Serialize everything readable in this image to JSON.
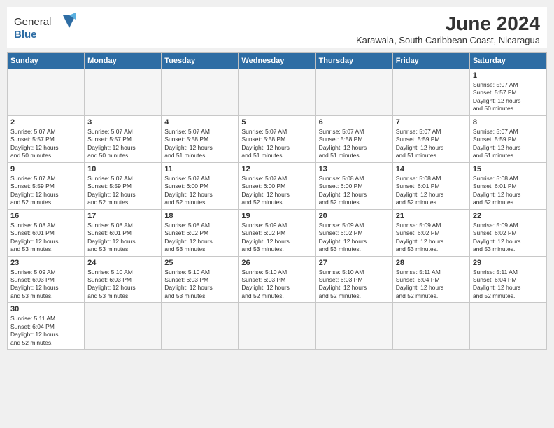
{
  "header": {
    "logo_general": "General",
    "logo_blue": "Blue",
    "main_title": "June 2024",
    "subtitle": "Karawala, South Caribbean Coast, Nicaragua"
  },
  "weekdays": [
    "Sunday",
    "Monday",
    "Tuesday",
    "Wednesday",
    "Thursday",
    "Friday",
    "Saturday"
  ],
  "weeks": [
    [
      {
        "day": "",
        "info": ""
      },
      {
        "day": "",
        "info": ""
      },
      {
        "day": "",
        "info": ""
      },
      {
        "day": "",
        "info": ""
      },
      {
        "day": "",
        "info": ""
      },
      {
        "day": "",
        "info": ""
      },
      {
        "day": "1",
        "info": "Sunrise: 5:07 AM\nSunset: 5:57 PM\nDaylight: 12 hours\nand 50 minutes."
      }
    ],
    [
      {
        "day": "2",
        "info": "Sunrise: 5:07 AM\nSunset: 5:57 PM\nDaylight: 12 hours\nand 50 minutes."
      },
      {
        "day": "3",
        "info": "Sunrise: 5:07 AM\nSunset: 5:57 PM\nDaylight: 12 hours\nand 50 minutes."
      },
      {
        "day": "4",
        "info": "Sunrise: 5:07 AM\nSunset: 5:58 PM\nDaylight: 12 hours\nand 51 minutes."
      },
      {
        "day": "5",
        "info": "Sunrise: 5:07 AM\nSunset: 5:58 PM\nDaylight: 12 hours\nand 51 minutes."
      },
      {
        "day": "6",
        "info": "Sunrise: 5:07 AM\nSunset: 5:58 PM\nDaylight: 12 hours\nand 51 minutes."
      },
      {
        "day": "7",
        "info": "Sunrise: 5:07 AM\nSunset: 5:59 PM\nDaylight: 12 hours\nand 51 minutes."
      },
      {
        "day": "8",
        "info": "Sunrise: 5:07 AM\nSunset: 5:59 PM\nDaylight: 12 hours\nand 51 minutes."
      }
    ],
    [
      {
        "day": "9",
        "info": "Sunrise: 5:07 AM\nSunset: 5:59 PM\nDaylight: 12 hours\nand 52 minutes."
      },
      {
        "day": "10",
        "info": "Sunrise: 5:07 AM\nSunset: 5:59 PM\nDaylight: 12 hours\nand 52 minutes."
      },
      {
        "day": "11",
        "info": "Sunrise: 5:07 AM\nSunset: 6:00 PM\nDaylight: 12 hours\nand 52 minutes."
      },
      {
        "day": "12",
        "info": "Sunrise: 5:07 AM\nSunset: 6:00 PM\nDaylight: 12 hours\nand 52 minutes."
      },
      {
        "day": "13",
        "info": "Sunrise: 5:08 AM\nSunset: 6:00 PM\nDaylight: 12 hours\nand 52 minutes."
      },
      {
        "day": "14",
        "info": "Sunrise: 5:08 AM\nSunset: 6:01 PM\nDaylight: 12 hours\nand 52 minutes."
      },
      {
        "day": "15",
        "info": "Sunrise: 5:08 AM\nSunset: 6:01 PM\nDaylight: 12 hours\nand 52 minutes."
      }
    ],
    [
      {
        "day": "16",
        "info": "Sunrise: 5:08 AM\nSunset: 6:01 PM\nDaylight: 12 hours\nand 53 minutes."
      },
      {
        "day": "17",
        "info": "Sunrise: 5:08 AM\nSunset: 6:01 PM\nDaylight: 12 hours\nand 53 minutes."
      },
      {
        "day": "18",
        "info": "Sunrise: 5:08 AM\nSunset: 6:02 PM\nDaylight: 12 hours\nand 53 minutes."
      },
      {
        "day": "19",
        "info": "Sunrise: 5:09 AM\nSunset: 6:02 PM\nDaylight: 12 hours\nand 53 minutes."
      },
      {
        "day": "20",
        "info": "Sunrise: 5:09 AM\nSunset: 6:02 PM\nDaylight: 12 hours\nand 53 minutes."
      },
      {
        "day": "21",
        "info": "Sunrise: 5:09 AM\nSunset: 6:02 PM\nDaylight: 12 hours\nand 53 minutes."
      },
      {
        "day": "22",
        "info": "Sunrise: 5:09 AM\nSunset: 6:02 PM\nDaylight: 12 hours\nand 53 minutes."
      }
    ],
    [
      {
        "day": "23",
        "info": "Sunrise: 5:09 AM\nSunset: 6:03 PM\nDaylight: 12 hours\nand 53 minutes."
      },
      {
        "day": "24",
        "info": "Sunrise: 5:10 AM\nSunset: 6:03 PM\nDaylight: 12 hours\nand 53 minutes."
      },
      {
        "day": "25",
        "info": "Sunrise: 5:10 AM\nSunset: 6:03 PM\nDaylight: 12 hours\nand 53 minutes."
      },
      {
        "day": "26",
        "info": "Sunrise: 5:10 AM\nSunset: 6:03 PM\nDaylight: 12 hours\nand 52 minutes."
      },
      {
        "day": "27",
        "info": "Sunrise: 5:10 AM\nSunset: 6:03 PM\nDaylight: 12 hours\nand 52 minutes."
      },
      {
        "day": "28",
        "info": "Sunrise: 5:11 AM\nSunset: 6:04 PM\nDaylight: 12 hours\nand 52 minutes."
      },
      {
        "day": "29",
        "info": "Sunrise: 5:11 AM\nSunset: 6:04 PM\nDaylight: 12 hours\nand 52 minutes."
      }
    ],
    [
      {
        "day": "30",
        "info": "Sunrise: 5:11 AM\nSunset: 6:04 PM\nDaylight: 12 hours\nand 52 minutes."
      },
      {
        "day": "",
        "info": ""
      },
      {
        "day": "",
        "info": ""
      },
      {
        "day": "",
        "info": ""
      },
      {
        "day": "",
        "info": ""
      },
      {
        "day": "",
        "info": ""
      },
      {
        "day": "",
        "info": ""
      }
    ]
  ]
}
